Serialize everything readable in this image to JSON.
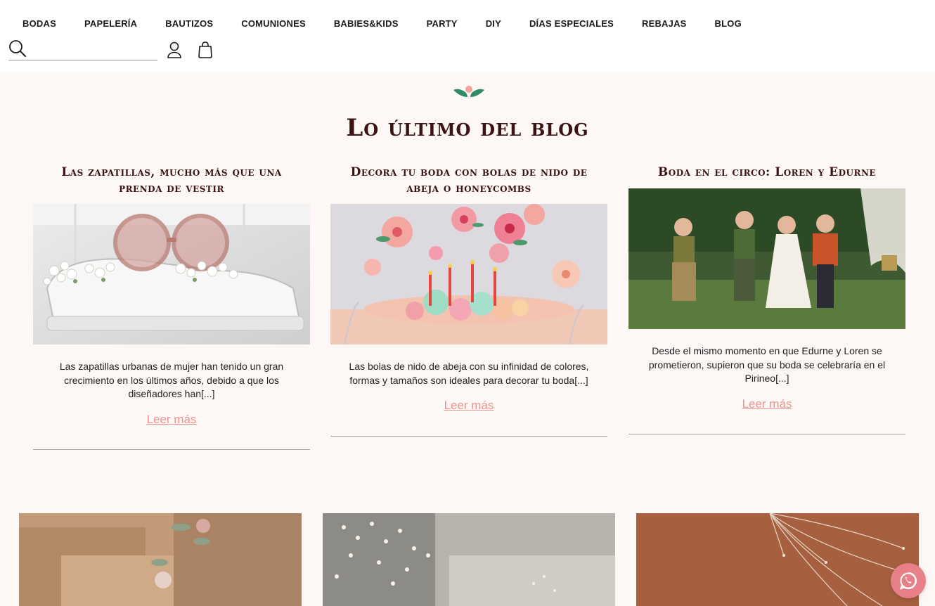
{
  "nav": {
    "items": [
      "BODAS",
      "PAPELERÍA",
      "BAUTIZOS",
      "COMUNIONES",
      "BABIES&KIDS",
      "PARTY",
      "DIY",
      "DÍAS ESPECIALES",
      "REBAJAS",
      "BLOG"
    ]
  },
  "search": {
    "value": "",
    "placeholder": ""
  },
  "section": {
    "title": "Lo último del blog"
  },
  "posts": [
    {
      "title": "Las zapatillas, mucho más que una prenda de vestir",
      "excerpt": "Las zapatillas urbanas de mujer han tenido un gran crecimiento en los últimos años, debido a que los diseñadores han[...]",
      "more": "Leer más"
    },
    {
      "title": "Decora tu boda con bolas de nido de abeja o honeycombs",
      "excerpt": "Las bolas de nido de abeja con su infinidad de colores, formas y tamaños son ideales para decorar tu boda[...]",
      "more": "Leer más"
    },
    {
      "title": "Boda en el circo: Loren y Edurne",
      "excerpt": "Desde el mismo momento en que Edurne y Loren se prometieron, supieron que su boda se celebraría en el Pirineo[...]",
      "more": "Leer más"
    }
  ],
  "colors": {
    "accent": "#e8968f",
    "title": "#3a1414",
    "background": "#fdf7f6",
    "whatsapp": "#e8808a"
  },
  "icons": [
    "search-icon",
    "user-icon",
    "shopping-bag-icon",
    "leaf-icon",
    "whatsapp-icon"
  ]
}
